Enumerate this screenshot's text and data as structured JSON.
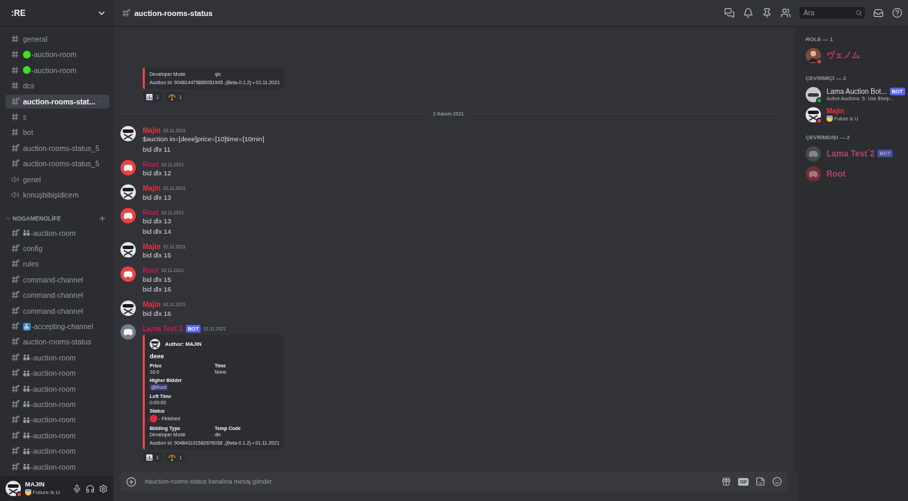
{
  "sidebar": {
    "server_name": ":RE",
    "channels": [
      {
        "name": "general",
        "kind": "text",
        "selected": false
      },
      {
        "name": "-auction-room",
        "kind": "text",
        "prefix": {
          "kind": "green-dot"
        },
        "selected": false
      },
      {
        "name": "-auction-room",
        "kind": "text",
        "prefix": {
          "kind": "green-dot"
        },
        "selected": false
      },
      {
        "name": "dcs",
        "kind": "text",
        "selected": false
      },
      {
        "name": "auction-rooms-stat...",
        "kind": "thread",
        "selected": true
      },
      {
        "name": "s",
        "kind": "text",
        "selected": false
      },
      {
        "name": "bot",
        "kind": "text",
        "selected": false
      },
      {
        "name": "auction-rooms-status_5",
        "kind": "thread",
        "selected": false
      },
      {
        "name": "auction-rooms-status_5",
        "kind": "thread",
        "selected": false
      },
      {
        "name": "genel",
        "kind": "voice",
        "selected": false
      },
      {
        "name": "konuşbibişidicem",
        "kind": "voice",
        "selected": false
      }
    ],
    "category": {
      "name": "NOGAMENOLİFE",
      "expanded": true,
      "channels": [
        {
          "name": "-auction-room",
          "kind": "thread",
          "prefix": {
            "kind": "people"
          },
          "selected": false
        },
        {
          "name": "config",
          "kind": "thread",
          "selected": false
        },
        {
          "name": "rules",
          "kind": "thread",
          "selected": false
        },
        {
          "name": "command-channel",
          "kind": "thread",
          "selected": false
        },
        {
          "name": "command-channel",
          "kind": "thread",
          "selected": false
        },
        {
          "name": "command-channel",
          "kind": "thread",
          "selected": false
        },
        {
          "name": "-accepting-channel",
          "kind": "thread",
          "prefix": {
            "kind": "accessible"
          },
          "selected": false
        },
        {
          "name": "auction-rooms-status",
          "kind": "thread",
          "selected": false
        },
        {
          "name": "-auction-room",
          "kind": "thread",
          "prefix": {
            "kind": "people"
          },
          "selected": false
        },
        {
          "name": "-auction-room",
          "kind": "thread",
          "prefix": {
            "kind": "people"
          },
          "selected": false
        },
        {
          "name": "-auction-room",
          "kind": "thread",
          "prefix": {
            "kind": "people"
          },
          "selected": false
        },
        {
          "name": "-auction-room",
          "kind": "thread",
          "prefix": {
            "kind": "people"
          },
          "selected": false
        },
        {
          "name": "-auction-room",
          "kind": "thread",
          "prefix": {
            "kind": "people"
          },
          "selected": false
        },
        {
          "name": "-auction-room",
          "kind": "thread",
          "prefix": {
            "kind": "people"
          },
          "selected": false
        },
        {
          "name": "-auction-room",
          "kind": "thread",
          "prefix": {
            "kind": "people"
          },
          "selected": false
        },
        {
          "name": "-auction-room",
          "kind": "thread",
          "prefix": {
            "kind": "people"
          },
          "selected": false
        }
      ]
    },
    "user": {
      "name": "MAJIN",
      "presence": {
        "kind": "dnd"
      },
      "custom_status": "Future is U"
    }
  },
  "header": {
    "channel": "auction-rooms-status",
    "search_placeholder": "Ara"
  },
  "messages": [
    {
      "kind": "continued",
      "embed": {
        "color": "#ed4245",
        "fields": [
          {
            "value": "Developer Mode",
            "inline": true,
            "kind": "text"
          },
          {
            "value": "qix",
            "inline": true,
            "kind": "text"
          }
        ],
        "footer": "Auction Id: 904814475885051945 ,(Beta-0.1.2) • 01.11.2021"
      },
      "reactions": [
        {
          "kind": "chart",
          "count": "1"
        },
        {
          "kind": "scales",
          "count": "1"
        }
      ]
    },
    {
      "kind": "date-divider",
      "label": "2 Kasım 2021"
    },
    {
      "kind": "message",
      "author": "Majin",
      "color": "#e5343d",
      "avatar": {
        "kind": "ninja"
      },
      "time": "02.11.2021",
      "lines": [
        "$auction in=[deee]price=[10]time=[10min]",
        "bid dlx 11"
      ]
    },
    {
      "kind": "message",
      "author": "Root",
      "color": "#c7195a",
      "avatar": {
        "kind": "default",
        "color": "#ed4245"
      },
      "time": "02.11.2021",
      "lines": [
        "bid dlx 12"
      ]
    },
    {
      "kind": "message",
      "author": "Majin",
      "color": "#e5343d",
      "avatar": {
        "kind": "ninja"
      },
      "time": "02.11.2021",
      "lines": [
        "bid dlx 13"
      ]
    },
    {
      "kind": "message",
      "author": "Root",
      "color": "#c7195a",
      "avatar": {
        "kind": "default",
        "color": "#ed4245"
      },
      "time": "02.11.2021",
      "lines": [
        "bid dlx 13",
        "bid dlx 14"
      ]
    },
    {
      "kind": "message",
      "author": "Majin",
      "color": "#e5343d",
      "avatar": {
        "kind": "ninja"
      },
      "time": "02.11.2021",
      "lines": [
        "bid dlx 15"
      ]
    },
    {
      "kind": "message",
      "author": "Root",
      "color": "#c7195a",
      "avatar": {
        "kind": "default",
        "color": "#ed4245"
      },
      "time": "02.11.2021",
      "lines": [
        "bid dlx 15",
        "bid dlx 16"
      ]
    },
    {
      "kind": "message",
      "author": "Majin",
      "color": "#e5343d",
      "avatar": {
        "kind": "ninja"
      },
      "time": "02.11.2021",
      "lines": [
        "bid dlx 16"
      ]
    },
    {
      "kind": "message",
      "author": "Lama Test`2",
      "color": "#c7195a",
      "avatar": {
        "kind": "default",
        "color": "#747f8d"
      },
      "tag": "BOT",
      "time": "02.11.2021",
      "embed": {
        "color": "#ed4245",
        "author": "Author: MAJIN",
        "title": "deee",
        "fields": [
          {
            "name": "Price",
            "value": "16.0",
            "inline": true,
            "kind": "text"
          },
          {
            "name": "Time",
            "value": "None",
            "inline": true,
            "kind": "text"
          },
          {
            "name": "Higher Bidder",
            "value": "@Root",
            "inline": false,
            "kind": "mention"
          },
          {
            "name": "Left Time",
            "value": "0:00:00",
            "inline": false,
            "kind": "text"
          },
          {
            "name": "Status",
            "value": "- Finished",
            "inline": false,
            "kind": "status",
            "color": "#dd2e44"
          },
          {
            "name": "Bidding Type",
            "value": "Developer Mode",
            "inline": true,
            "kind": "text"
          },
          {
            "name": "Temp Code",
            "value": "dlx",
            "inline": true,
            "kind": "text"
          }
        ],
        "footer": "Auction Id: 904841101582676038 ,(Beta-0.1.2) • 01.11.2021"
      },
      "reactions": [
        {
          "kind": "chart",
          "count": "1"
        },
        {
          "kind": "scales",
          "count": "1"
        }
      ]
    }
  ],
  "composer": {
    "placeholder": "#auction-rooms-status kanalına mesaj gönder",
    "gif_label": "GIF"
  },
  "members": [
    {
      "title": "ROLE — 1",
      "members": [
        {
          "name": "ヴェノム",
          "color": "#e0306a",
          "presence": {
            "kind": "dnd"
          },
          "avatar": {
            "kind": "person"
          }
        }
      ]
    },
    {
      "title": "ÇEVRİMİÇİ — 2",
      "members": [
        {
          "name": "Lama Auction Bot...",
          "color": "#dbdee1",
          "presence": {
            "kind": "online"
          },
          "avatar": {
            "kind": "robot"
          },
          "tag": "BOT",
          "subtitle": "Active Auctions :5. Use $help..."
        },
        {
          "name": "Majin",
          "color": "#e5343d",
          "presence": {
            "kind": "dnd"
          },
          "avatar": {
            "kind": "ninja"
          },
          "subtitle": "Future is U",
          "subtitle_emoji": true
        }
      ]
    },
    {
      "title": "ÇEVRİMDIŞI — 2",
      "members": [
        {
          "name": "Lama Test`2",
          "color": "#b0436c",
          "presence": {
            "kind": "offline"
          },
          "avatar": {
            "kind": "default",
            "color": "#45484f"
          },
          "tag": "BOT"
        },
        {
          "name": "Root",
          "color": "#b0436c",
          "presence": {
            "kind": "offline"
          },
          "avatar": {
            "kind": "default",
            "color": "#6e3038"
          }
        }
      ]
    }
  ]
}
